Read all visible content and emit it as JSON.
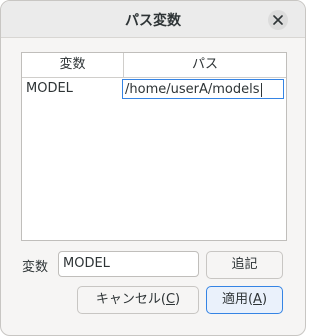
{
  "dialog": {
    "title": "パス変数",
    "close_icon": "close-icon"
  },
  "table": {
    "columns": [
      "変数",
      "パス"
    ],
    "rows": [
      {
        "variable": "MODEL",
        "path": "/home/userA/models"
      }
    ]
  },
  "form": {
    "variable_label": "変数",
    "variable_value": "MODEL",
    "add_label": "追記"
  },
  "buttons": {
    "cancel_prefix": "キャンセル(",
    "cancel_mnemonic": "C",
    "cancel_suffix": ")",
    "apply_prefix": "適用(",
    "apply_mnemonic": "A",
    "apply_suffix": ")"
  },
  "colors": {
    "accent": "#3584e4",
    "background": "#f6f5f4",
    "titlebar": "#ebebeb"
  }
}
